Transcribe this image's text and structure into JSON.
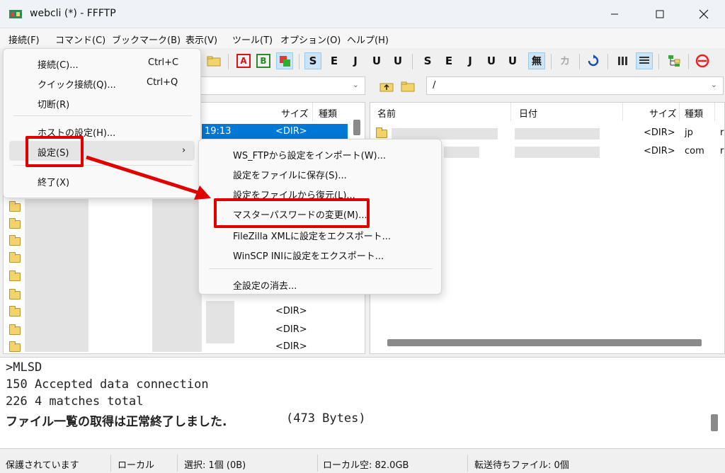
{
  "window": {
    "title": "webcli (*) - FFFTP"
  },
  "menubar": {
    "items": [
      "接続(F)",
      "コマンド(C)",
      "ブックマーク(B)",
      "表示(V)",
      "ツール(T)",
      "オプション(O)",
      "ヘルプ(H)"
    ]
  },
  "toolbar": {
    "buttons": [
      "S",
      "E",
      "J",
      "U",
      "U",
      "S",
      "E",
      "J",
      "U",
      "U",
      "無",
      "カ"
    ],
    "box_buttons": [
      "A",
      "B"
    ]
  },
  "left_path": {
    "value": ""
  },
  "right_path": {
    "value": "/"
  },
  "left_pane": {
    "headers": [
      "サイズ",
      "種類"
    ],
    "selected_row_time": "19:13",
    "dir_label": "<DIR>"
  },
  "right_pane": {
    "headers": [
      "名前",
      "日付",
      "サイズ",
      "種類"
    ],
    "rows": [
      {
        "size": "<DIR>",
        "type": "jp",
        "extra": "r"
      },
      {
        "size": "<DIR>",
        "type": "com",
        "extra": "r"
      }
    ]
  },
  "file_menu": {
    "items": [
      {
        "label": "接続(C)...",
        "shortcut": "Ctrl+C"
      },
      {
        "label": "クイック接続(Q)...",
        "shortcut": "Ctrl+Q"
      },
      {
        "label": "切断(R)",
        "shortcut": ""
      },
      {
        "label": "ホストの設定(H)...",
        "shortcut": ""
      },
      {
        "label": "設定(S)",
        "shortcut": "›"
      },
      {
        "label": "終了(X)",
        "shortcut": ""
      }
    ]
  },
  "settings_submenu": {
    "items": [
      "WS_FTPから設定をインポート(W)...",
      "設定をファイルに保存(S)...",
      "設定をファイルから復元(L)...",
      "マスターパスワードの変更(M)...",
      "FileZilla XMLに設定をエクスポート...",
      "WinSCP INIに設定をエクスポート...",
      "全設定の消去..."
    ]
  },
  "log": {
    "lines": [
      ">MLSD",
      "150 Accepted data connection",
      "226 4 matches total",
      "ファイル一覧の取得は正常終了しました.",
      "(473 Bytes)"
    ]
  },
  "statusbar": {
    "items": [
      "保護されています",
      "ローカル",
      "選択: 1個 (0B)",
      "ローカル空: 82.0GB",
      "転送待ちファイル: 0個"
    ]
  },
  "colors": {
    "highlight": "#e00000",
    "selection": "#0078d7",
    "folder": "#f3d36b"
  }
}
